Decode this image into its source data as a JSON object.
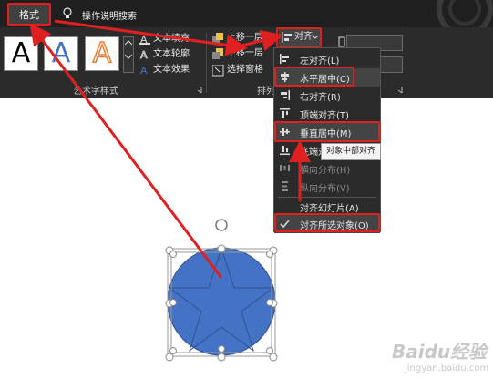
{
  "tabs": {
    "format": "格式",
    "tell_me": "操作说明搜索"
  },
  "ribbon": {
    "art_styles": [
      "A",
      "A",
      "A"
    ],
    "text_fill": "文本填充",
    "text_outline": "文本轮廓",
    "text_effects": "文本效果",
    "art_group_label": "艺术字样式",
    "bring_forward": "上移一层",
    "send_backward": "下移一层",
    "selection_pane": "选择窗格",
    "arrange_group_label": "排列",
    "align_button": "对齐"
  },
  "align_menu": {
    "items": [
      {
        "label": "左对齐(L)",
        "icon": "align-left-icon",
        "enabled": true
      },
      {
        "label": "水平居中(C)",
        "icon": "align-center-icon",
        "enabled": true
      },
      {
        "label": "右对齐(R)",
        "icon": "align-right-icon",
        "enabled": true
      },
      {
        "label": "顶端对齐(T)",
        "icon": "align-top-icon",
        "enabled": true
      },
      {
        "label": "垂直居中(M)",
        "icon": "align-middle-icon",
        "enabled": true
      },
      {
        "label": "底端对",
        "icon": "align-bottom-icon",
        "enabled": true
      },
      {
        "label": "横向分布(H)",
        "icon": "distribute-horizontal-icon",
        "enabled": false
      },
      {
        "label": "纵向分布(V)",
        "icon": "distribute-vertical-icon",
        "enabled": false
      },
      {
        "label": "对齐幻灯片(A)",
        "icon": "",
        "enabled": true
      },
      {
        "label": "对齐所选对象(O)",
        "icon": "check-icon",
        "enabled": true
      }
    ]
  },
  "tooltip": "对象中部对齐",
  "watermark": {
    "brand": "Baidu经验",
    "url": "jingyan.baidu.com"
  },
  "colors": {
    "shape_fill": "#4472c4",
    "highlight": "#e02020",
    "ribbon_bg": "#2b2b2b",
    "topbar_bg": "#1f1f1f"
  }
}
